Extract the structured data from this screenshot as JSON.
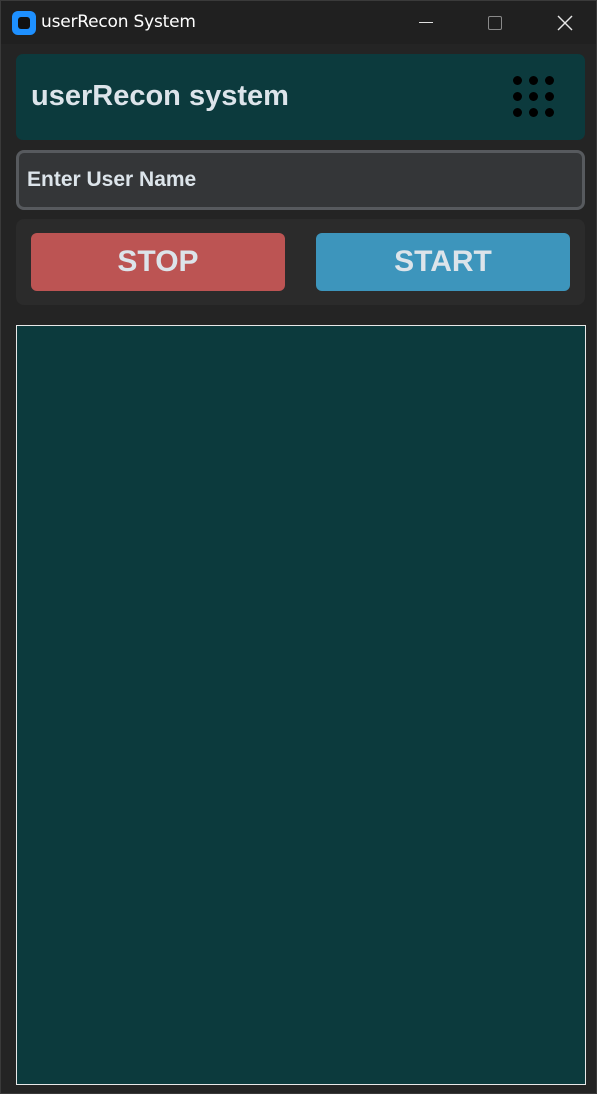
{
  "window": {
    "title": "userRecon System",
    "icons": {
      "app": "app-icon",
      "minimize": "minimize-icon",
      "maximize": "maximize-icon",
      "close": "close-icon"
    }
  },
  "header": {
    "title": "userRecon system",
    "menu_icon": "grid-dots-icon"
  },
  "input": {
    "placeholder": "Enter User Name",
    "value": ""
  },
  "actions": {
    "stop_label": "STOP",
    "start_label": "START"
  },
  "output": {
    "text": ""
  },
  "colors": {
    "background": "#242424",
    "header_bg": "#0c3a3d",
    "stop": "#bc5453",
    "start": "#3d95bc",
    "text": "#dce4ea"
  }
}
